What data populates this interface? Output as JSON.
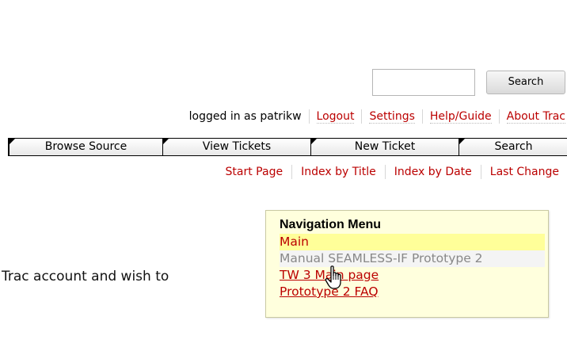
{
  "search": {
    "value": "",
    "button_label": "Search"
  },
  "metanav": {
    "logged_in_text": "logged in as patrikw",
    "links": [
      "Logout",
      "Settings",
      "Help/Guide",
      "About Trac"
    ]
  },
  "mainnav": {
    "tabs": [
      "Browse Source",
      "View Tickets",
      "New Ticket",
      "Search"
    ]
  },
  "ctxtnav": {
    "links": [
      "Start Page",
      "Index by Title",
      "Index by Date",
      "Last Change"
    ]
  },
  "content": {
    "partial_text": "Trac account and wish to"
  },
  "nav_menu": {
    "title": "Navigation Menu",
    "items": [
      "Main",
      "Manual SEAMLESS-IF Prototype 2",
      "TW 3 Main page",
      "Prototype 2 FAQ"
    ]
  },
  "colors": {
    "link": "#bb0000",
    "menu_bg": "#ffffdd",
    "menu_highlight": "#ffff99"
  },
  "icons": {
    "cursor": "hand-pointer-icon"
  }
}
